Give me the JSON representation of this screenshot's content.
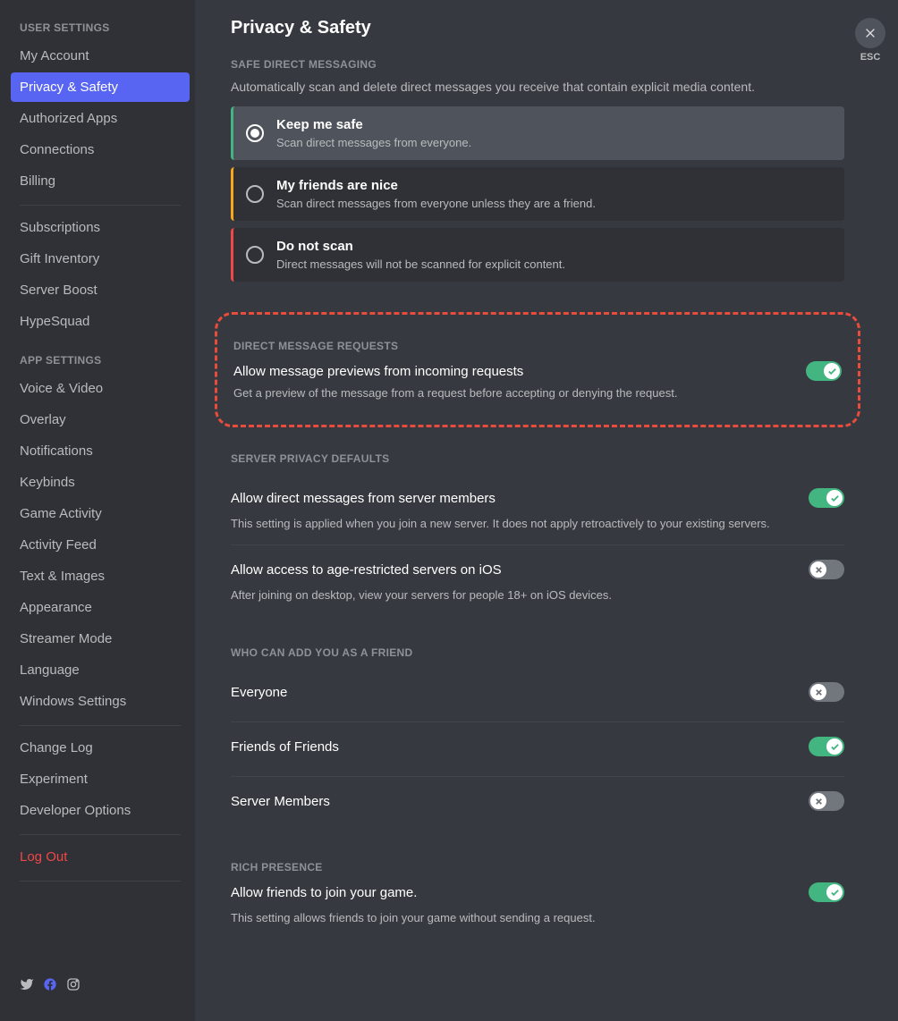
{
  "sidebar": {
    "header_user": "USER SETTINGS",
    "header_app": "APP SETTINGS",
    "items_user": [
      {
        "label": "My Account"
      },
      {
        "label": "Privacy & Safety",
        "active": true
      },
      {
        "label": "Authorized Apps"
      },
      {
        "label": "Connections"
      },
      {
        "label": "Billing"
      }
    ],
    "items_user2": [
      {
        "label": "Subscriptions"
      },
      {
        "label": "Gift Inventory"
      },
      {
        "label": "Server Boost"
      },
      {
        "label": "HypeSquad"
      }
    ],
    "items_app": [
      {
        "label": "Voice & Video"
      },
      {
        "label": "Overlay"
      },
      {
        "label": "Notifications"
      },
      {
        "label": "Keybinds"
      },
      {
        "label": "Game Activity"
      },
      {
        "label": "Activity Feed"
      },
      {
        "label": "Text & Images"
      },
      {
        "label": "Appearance"
      },
      {
        "label": "Streamer Mode"
      },
      {
        "label": "Language"
      },
      {
        "label": "Windows Settings"
      }
    ],
    "items_misc": [
      {
        "label": "Change Log"
      },
      {
        "label": "Experiment"
      },
      {
        "label": "Developer Options"
      }
    ],
    "logout": "Log Out"
  },
  "esc_label": "ESC",
  "page": {
    "title": "Privacy & Safety",
    "safe_dm": {
      "header": "SAFE DIRECT MESSAGING",
      "desc": "Automatically scan and delete direct messages you receive that contain explicit media content.",
      "options": [
        {
          "title": "Keep me safe",
          "sub": "Scan direct messages from everyone.",
          "selected": true,
          "color": "green"
        },
        {
          "title": "My friends are nice",
          "sub": "Scan direct messages from everyone unless they are a friend.",
          "color": "yellow"
        },
        {
          "title": "Do not scan",
          "sub": "Direct messages will not be scanned for explicit content.",
          "color": "red"
        }
      ]
    },
    "dm_requests": {
      "header": "DIRECT MESSAGE REQUESTS",
      "title": "Allow message previews from incoming requests",
      "desc": "Get a preview of the message from a request before accepting or denying the request.",
      "on": true
    },
    "server_privacy": {
      "header": "SERVER PRIVACY DEFAULTS",
      "settings": [
        {
          "title": "Allow direct messages from server members",
          "desc": "This setting is applied when you join a new server. It does not apply retroactively to your existing servers.",
          "on": true
        },
        {
          "title": "Allow access to age-restricted servers on iOS",
          "desc": "After joining on desktop, view your servers for people 18+ on iOS devices.",
          "on": false
        }
      ]
    },
    "friend_add": {
      "header": "WHO CAN ADD YOU AS A FRIEND",
      "settings": [
        {
          "title": "Everyone",
          "on": false
        },
        {
          "title": "Friends of Friends",
          "on": true
        },
        {
          "title": "Server Members",
          "on": false
        }
      ]
    },
    "rich_presence": {
      "header": "RICH PRESENCE",
      "title": "Allow friends to join your game.",
      "desc": "This setting allows friends to join your game without sending a request.",
      "on": true
    }
  }
}
